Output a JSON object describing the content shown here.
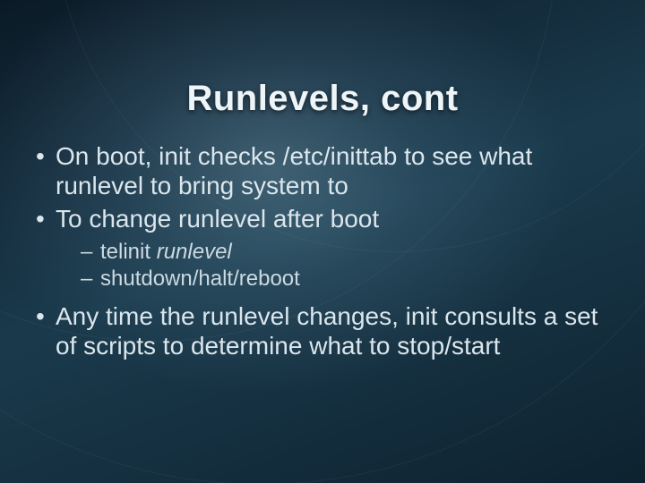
{
  "title": "Runlevels, cont",
  "bullets": {
    "b1": "On boot, init checks /etc/inittab to see what runlevel to bring system to",
    "b2": "To change runlevel after boot",
    "b2_sub": {
      "s1_pre": "telinit ",
      "s1_em": "runlevel",
      "s2": "shutdown/halt/reboot"
    },
    "b3": "Any time the runlevel changes, init consults a set of scripts to determine what to stop/start"
  }
}
